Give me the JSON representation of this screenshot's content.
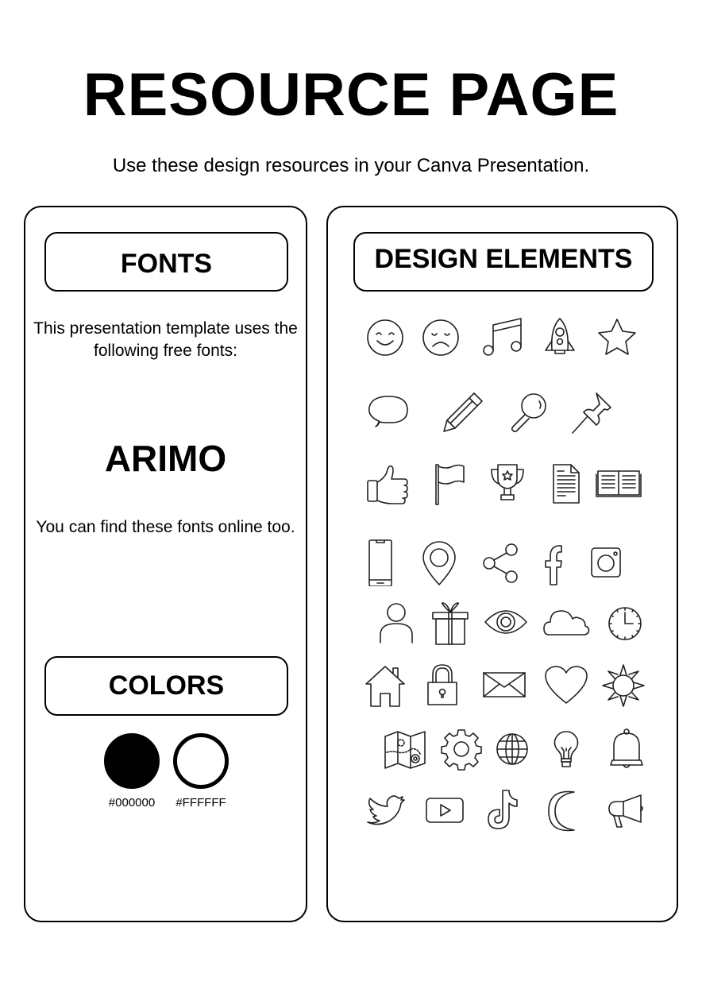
{
  "header": {
    "title": "RESOURCE PAGE",
    "subtitle": "Use these design resources in your Canva Presentation."
  },
  "fonts": {
    "heading": "FONTS",
    "intro": "This presentation template uses the following free fonts:",
    "font_names": [
      "ARIMO"
    ],
    "note": "You can find these fonts online too."
  },
  "colors": {
    "heading": "COLORS",
    "swatches": [
      {
        "hex": "#000000",
        "label": "#000000"
      },
      {
        "hex": "#FFFFFF",
        "label": "#FFFFFF"
      }
    ]
  },
  "design_elements": {
    "heading": "DESIGN ELEMENTS",
    "icons": [
      [
        "smiley-face-icon",
        "sad-face-icon",
        "music-note-icon",
        "rocket-icon",
        "star-icon"
      ],
      [
        "speech-bubble-icon",
        "pencil-icon",
        "magnifier-icon",
        "push-pin-icon"
      ],
      [
        "thumbs-up-icon",
        "flag-icon",
        "trophy-icon",
        "document-icon",
        "open-book-icon"
      ],
      [
        "smartphone-icon",
        "location-pin-icon",
        "share-icon",
        "facebook-icon",
        "instagram-icon"
      ],
      [
        "user-icon",
        "gift-icon",
        "eye-icon",
        "cloud-icon",
        "clock-icon"
      ],
      [
        "house-icon",
        "padlock-icon",
        "envelope-icon",
        "heart-icon",
        "sun-icon"
      ],
      [
        "map-icon",
        "gear-icon",
        "globe-icon",
        "light-bulb-icon",
        "bell-icon"
      ],
      [
        "twitter-bird-icon",
        "play-button-icon",
        "tiktok-icon",
        "crescent-moon-icon",
        "megaphone-icon"
      ]
    ]
  }
}
